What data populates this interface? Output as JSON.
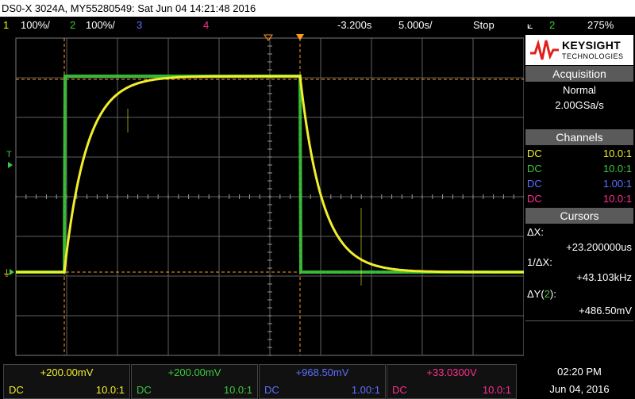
{
  "title": "DS0-X 3024A, MY55280549: Sat Jun 04 14:21:48 2016",
  "colors": {
    "ch1": "#f2ee2b",
    "ch2": "#3cc93c",
    "ch3": "#5b6fff",
    "ch4": "#ff2f8f",
    "cursor": "#ff9a1a",
    "grid": "#7a7a7a"
  },
  "status": {
    "ch1_num": "1",
    "ch1_scale": "100%/",
    "ch2_num": "2",
    "ch2_scale": "100%/",
    "ch3_num": "3",
    "ch4_num": "4",
    "delay": "-3.200s",
    "timebase": "5.000s/",
    "run_state": "Stop",
    "trigger_icon": "trigger-edge-icon",
    "trigger_ch": "2",
    "trigger_level": "275%"
  },
  "panel": {
    "logo_name": "KEYSIGHT",
    "logo_sub": "TECHNOLOGIES",
    "acq_header": "Acquisition",
    "acq_mode": "Normal",
    "acq_rate": "2.00GSa/s",
    "channels_header": "Channels",
    "channels": [
      {
        "coupling": "DC",
        "probe": "10.0:1"
      },
      {
        "coupling": "DC",
        "probe": "10.0:1"
      },
      {
        "coupling": "DC",
        "probe": "1.00:1"
      },
      {
        "coupling": "DC",
        "probe": "10.0:1"
      }
    ],
    "cursors_header": "Cursors",
    "dx_label": "ΔX:",
    "dx_value": "+23.200000us",
    "inv_label": "1/ΔX:",
    "inv_value": "+43.103kHz",
    "dy_label_prefix": "ΔY(",
    "dy_label_ch": "2",
    "dy_label_suffix": "):",
    "dy_value": "+486.50mV"
  },
  "bottom": {
    "channels": [
      {
        "offset": "+200.00mV",
        "coupling": "DC",
        "probe": "10.0:1"
      },
      {
        "offset": "+200.00mV",
        "coupling": "DC",
        "probe": "10.0:1"
      },
      {
        "offset": "+968.50mV",
        "coupling": "DC",
        "probe": "1.00:1"
      },
      {
        "offset": "+33.0300V",
        "coupling": "DC",
        "probe": "10.0:1"
      }
    ],
    "time": "02:20 PM",
    "date": "Jun 04, 2016"
  },
  "markers": {
    "trigger_label": "T"
  }
}
